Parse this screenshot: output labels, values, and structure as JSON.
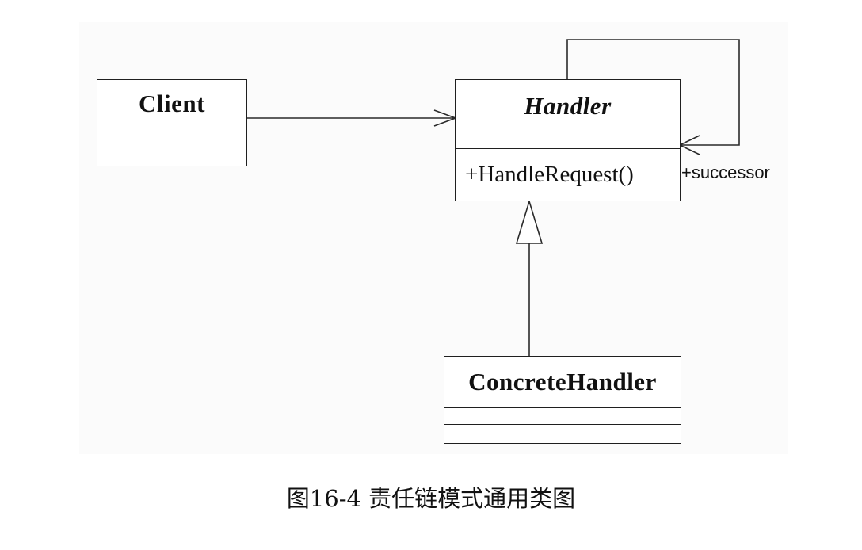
{
  "diagram": {
    "type": "uml-class-diagram",
    "classes": {
      "client": {
        "name": "Client",
        "operations": []
      },
      "handler": {
        "name": "Handler",
        "abstract": true,
        "operations": [
          "+HandleRequest()"
        ]
      },
      "concrete_handler": {
        "name": "ConcreteHandler",
        "operations": []
      }
    },
    "associations": [
      {
        "from": "Client",
        "to": "Handler",
        "kind": "association",
        "navigable": true
      },
      {
        "from": "Handler",
        "to": "Handler",
        "kind": "self-association",
        "role": "+successor"
      },
      {
        "from": "ConcreteHandler",
        "to": "Handler",
        "kind": "generalization"
      }
    ]
  },
  "caption": "图16-4 责任链模式通用类图"
}
